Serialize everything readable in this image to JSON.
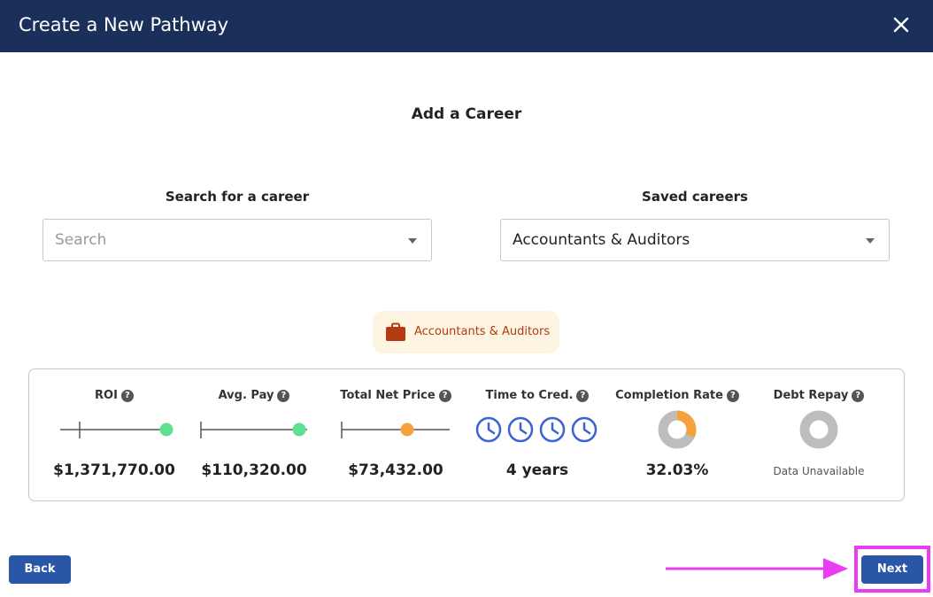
{
  "header": {
    "title": "Create a New Pathway"
  },
  "main": {
    "section_title": "Add a Career",
    "search": {
      "label": "Search for a career",
      "placeholder": "Search"
    },
    "saved": {
      "label": "Saved careers",
      "selected": "Accountants & Auditors"
    },
    "chip": {
      "label": "Accountants & Auditors",
      "icon": "briefcase-icon"
    }
  },
  "stats": [
    {
      "title": "ROI",
      "value": "$1,371,770.00",
      "indicator": "slider",
      "level": 1.0,
      "color": "#5de092"
    },
    {
      "title": "Avg. Pay",
      "value": "$110,320.00",
      "indicator": "slider",
      "level": 1.0,
      "color": "#5de092"
    },
    {
      "title": "Total Net Price",
      "value": "$73,432.00",
      "indicator": "slider",
      "level": 0.6,
      "color": "#f6a23c"
    },
    {
      "title": "Time to Cred.",
      "value": "4 years",
      "indicator": "clocks",
      "count": 4,
      "color": "#3b63d4"
    },
    {
      "title": "Completion Rate",
      "value": "32.03%",
      "indicator": "donut",
      "percent": 32.03,
      "color": "#f6a23c"
    },
    {
      "title": "Debt Repay",
      "value": "Data Unavailable",
      "indicator": "donut",
      "percent": 0,
      "color": "#bdbdbd"
    }
  ],
  "footer": {
    "back_label": "Back",
    "next_label": "Next"
  },
  "colors": {
    "header": "#1b2f5b",
    "button": "#2a56a8",
    "highlight": "#ea3cf2"
  }
}
